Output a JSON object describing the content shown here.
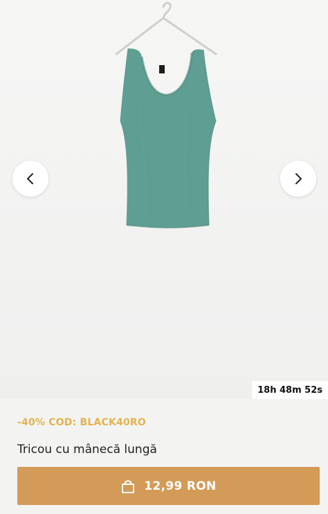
{
  "product": {
    "countdown": "18h 48m 52s",
    "promo": "-40% COD: BLACK40RO",
    "title": "Tricou cu mânecă lungă",
    "price": "12,99 RON",
    "garment_color": "#5f9e92"
  },
  "carousel": {
    "prev_icon": "chevron-left-icon",
    "next_icon": "chevron-right-icon"
  },
  "colors": {
    "accent": "#d49a57",
    "promo": "#e2b450"
  }
}
